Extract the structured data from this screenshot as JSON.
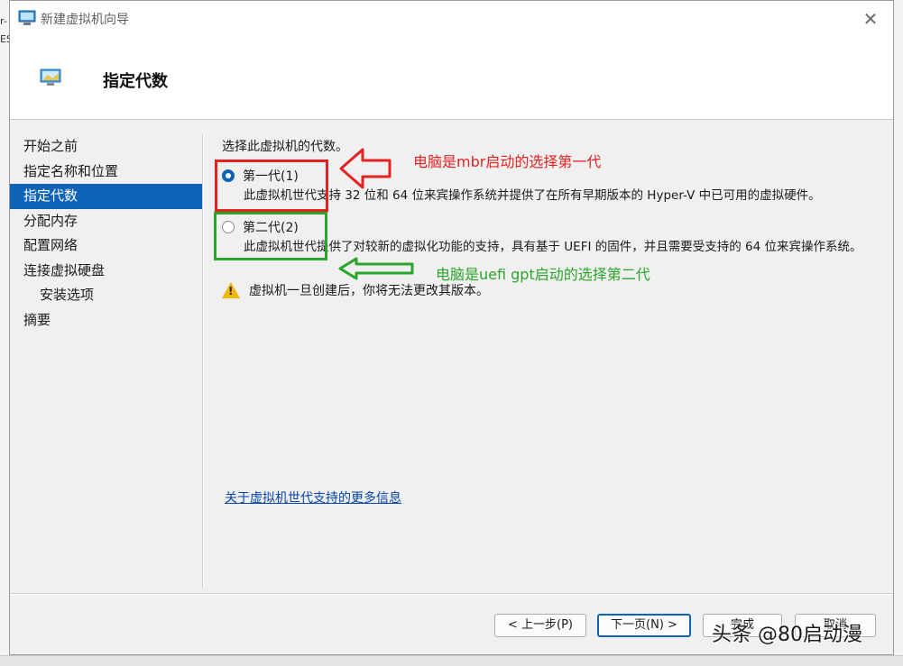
{
  "background": {
    "fragments": [
      "r-",
      "ES"
    ]
  },
  "window": {
    "title": "新建虚拟机向导",
    "close_glyph": "✕"
  },
  "header": {
    "title": "指定代数"
  },
  "nav": {
    "items": [
      {
        "label": "开始之前"
      },
      {
        "label": "指定名称和位置"
      },
      {
        "label": "指定代数"
      },
      {
        "label": "分配内存"
      },
      {
        "label": "配置网络"
      },
      {
        "label": "连接虚拟硬盘"
      },
      {
        "label": "安装选项"
      },
      {
        "label": "摘要"
      }
    ],
    "active_index": 2
  },
  "content": {
    "prompt": "选择此虚拟机的代数。",
    "options": [
      {
        "label": "第一代(1)",
        "checked": true,
        "description": "此虚拟机世代支持 32 位和 64 位来宾操作系统并提供了在所有早期版本的 Hyper-V 中已可用的虚拟硬件。"
      },
      {
        "label": "第二代(2)",
        "checked": false,
        "description": "此虚拟机世代提供了对较新的虚拟化功能的支持，具有基于 UEFI 的固件，并且需要受支持的 64 位来宾操作系统。"
      }
    ],
    "warning": "虚拟机一旦创建后，你将无法更改其版本。",
    "more_info_link": "关于虚拟机世代支持的更多信息"
  },
  "buttons": {
    "prev": "< 上一步(P)",
    "next": "下一页(N) >",
    "finish": "完成",
    "cancel": "取消"
  },
  "annotations": {
    "red_text": "电脑是mbr启动的选择第一代",
    "green_text": "电脑是uefi gpt启动的选择第二代",
    "red_color": "#e52222",
    "green_color": "#2aa62a"
  },
  "watermark": "头条 @80启动漫"
}
